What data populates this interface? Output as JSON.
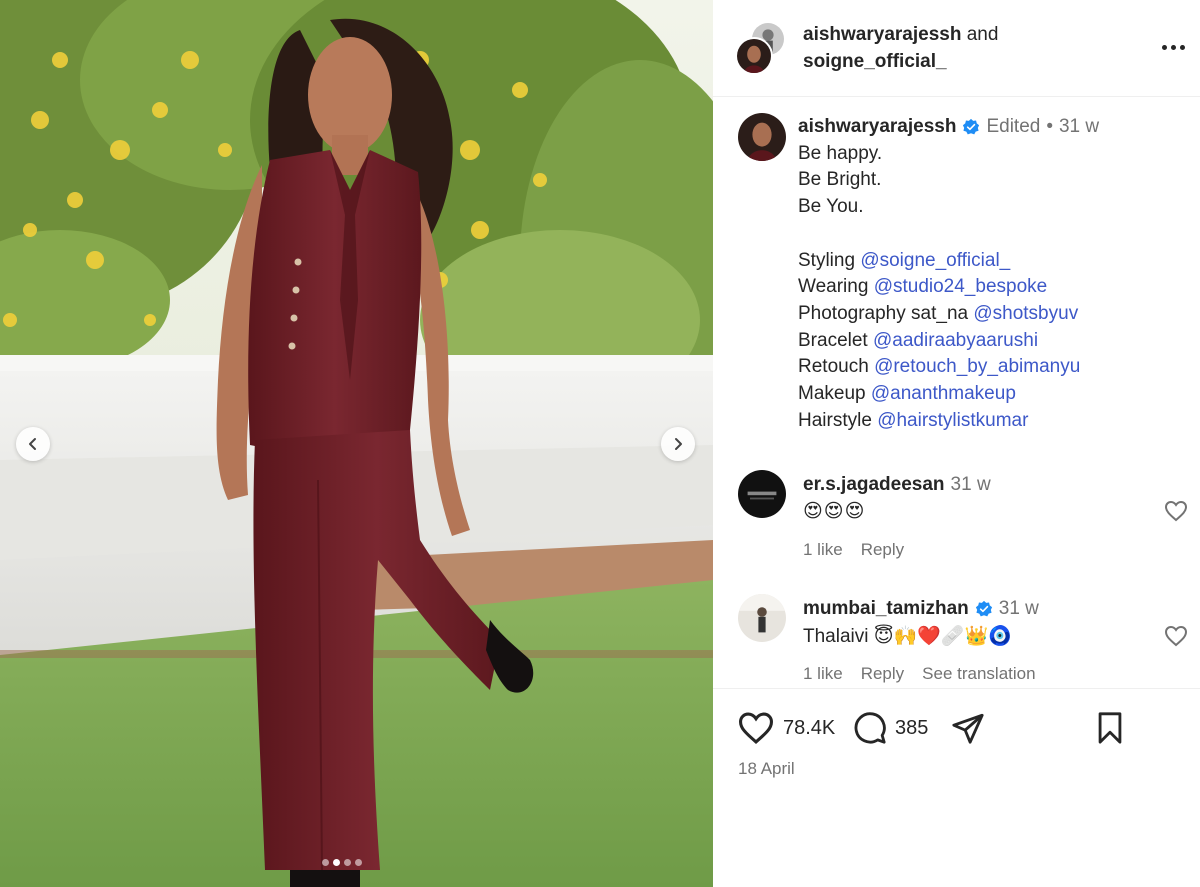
{
  "post": {
    "author": "aishwaryarajessh",
    "coauthor_conj": "and",
    "coauthor": "soigne_official_",
    "caption_edited": "Edited",
    "caption_sep": "•",
    "caption_time": "31 w",
    "caption_lines": [
      "Be happy.",
      "Be Bright.",
      "Be You."
    ],
    "credits": [
      {
        "label": "Styling",
        "handle": "@soigne_official_"
      },
      {
        "label": "Wearing",
        "handle": "@studio24_bespoke"
      },
      {
        "label": "Photography sat_na",
        "handle": "@shotsbyuv"
      },
      {
        "label": "Bracelet",
        "handle": "@aadiraabyaarushi"
      },
      {
        "label": "Retouch",
        "handle": "@retouch_by_abimanyu"
      },
      {
        "label": "Makeup",
        "handle": "@ananthmakeup"
      },
      {
        "label": "Hairstyle",
        "handle": "@hairstylistkumar"
      }
    ],
    "carousel": {
      "slides": 4,
      "active": 2
    }
  },
  "comments": [
    {
      "user": "er.s.jagadeesan",
      "time": "31 w",
      "text": "😍😍😍",
      "likes": "1 like",
      "reply": "Reply",
      "verified": false
    },
    {
      "user": "mumbai_tamizhan",
      "time": "31 w",
      "text": "Thalaivi 😇🙌❤️🩹👑🧿",
      "likes": "1 like",
      "reply": "Reply",
      "translate": "See translation",
      "verified": true
    }
  ],
  "stats": {
    "likes": "78.4K",
    "comments": "385",
    "date": "18 April"
  },
  "icons": {
    "more": "more-options-icon",
    "like": "heart-icon",
    "comment": "comment-icon",
    "share": "share-icon",
    "save": "bookmark-icon",
    "verified": "verified-badge-icon",
    "prev": "chevron-left-icon",
    "next": "chevron-right-icon"
  },
  "colors": {
    "link": "#3d58c8",
    "verified": "#1f8df5",
    "muted": "#737373",
    "outfit": "#6e1f26"
  }
}
